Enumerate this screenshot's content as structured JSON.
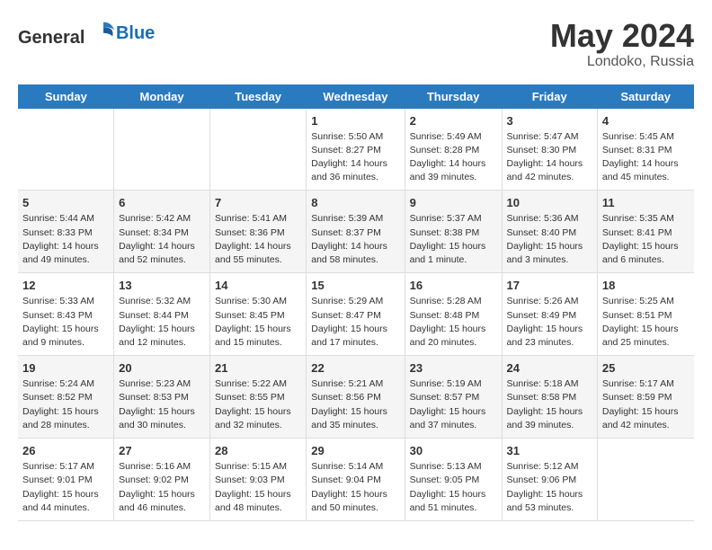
{
  "header": {
    "logo_general": "General",
    "logo_blue": "Blue",
    "month_year": "May 2024",
    "location": "Londoko, Russia"
  },
  "weekdays": [
    "Sunday",
    "Monday",
    "Tuesday",
    "Wednesday",
    "Thursday",
    "Friday",
    "Saturday"
  ],
  "weeks": [
    [
      {
        "day": "",
        "info": ""
      },
      {
        "day": "",
        "info": ""
      },
      {
        "day": "",
        "info": ""
      },
      {
        "day": "1",
        "info": "Sunrise: 5:50 AM\nSunset: 8:27 PM\nDaylight: 14 hours\nand 36 minutes."
      },
      {
        "day": "2",
        "info": "Sunrise: 5:49 AM\nSunset: 8:28 PM\nDaylight: 14 hours\nand 39 minutes."
      },
      {
        "day": "3",
        "info": "Sunrise: 5:47 AM\nSunset: 8:30 PM\nDaylight: 14 hours\nand 42 minutes."
      },
      {
        "day": "4",
        "info": "Sunrise: 5:45 AM\nSunset: 8:31 PM\nDaylight: 14 hours\nand 45 minutes."
      }
    ],
    [
      {
        "day": "5",
        "info": "Sunrise: 5:44 AM\nSunset: 8:33 PM\nDaylight: 14 hours\nand 49 minutes."
      },
      {
        "day": "6",
        "info": "Sunrise: 5:42 AM\nSunset: 8:34 PM\nDaylight: 14 hours\nand 52 minutes."
      },
      {
        "day": "7",
        "info": "Sunrise: 5:41 AM\nSunset: 8:36 PM\nDaylight: 14 hours\nand 55 minutes."
      },
      {
        "day": "8",
        "info": "Sunrise: 5:39 AM\nSunset: 8:37 PM\nDaylight: 14 hours\nand 58 minutes."
      },
      {
        "day": "9",
        "info": "Sunrise: 5:37 AM\nSunset: 8:38 PM\nDaylight: 15 hours\nand 1 minute."
      },
      {
        "day": "10",
        "info": "Sunrise: 5:36 AM\nSunset: 8:40 PM\nDaylight: 15 hours\nand 3 minutes."
      },
      {
        "day": "11",
        "info": "Sunrise: 5:35 AM\nSunset: 8:41 PM\nDaylight: 15 hours\nand 6 minutes."
      }
    ],
    [
      {
        "day": "12",
        "info": "Sunrise: 5:33 AM\nSunset: 8:43 PM\nDaylight: 15 hours\nand 9 minutes."
      },
      {
        "day": "13",
        "info": "Sunrise: 5:32 AM\nSunset: 8:44 PM\nDaylight: 15 hours\nand 12 minutes."
      },
      {
        "day": "14",
        "info": "Sunrise: 5:30 AM\nSunset: 8:45 PM\nDaylight: 15 hours\nand 15 minutes."
      },
      {
        "day": "15",
        "info": "Sunrise: 5:29 AM\nSunset: 8:47 PM\nDaylight: 15 hours\nand 17 minutes."
      },
      {
        "day": "16",
        "info": "Sunrise: 5:28 AM\nSunset: 8:48 PM\nDaylight: 15 hours\nand 20 minutes."
      },
      {
        "day": "17",
        "info": "Sunrise: 5:26 AM\nSunset: 8:49 PM\nDaylight: 15 hours\nand 23 minutes."
      },
      {
        "day": "18",
        "info": "Sunrise: 5:25 AM\nSunset: 8:51 PM\nDaylight: 15 hours\nand 25 minutes."
      }
    ],
    [
      {
        "day": "19",
        "info": "Sunrise: 5:24 AM\nSunset: 8:52 PM\nDaylight: 15 hours\nand 28 minutes."
      },
      {
        "day": "20",
        "info": "Sunrise: 5:23 AM\nSunset: 8:53 PM\nDaylight: 15 hours\nand 30 minutes."
      },
      {
        "day": "21",
        "info": "Sunrise: 5:22 AM\nSunset: 8:55 PM\nDaylight: 15 hours\nand 32 minutes."
      },
      {
        "day": "22",
        "info": "Sunrise: 5:21 AM\nSunset: 8:56 PM\nDaylight: 15 hours\nand 35 minutes."
      },
      {
        "day": "23",
        "info": "Sunrise: 5:19 AM\nSunset: 8:57 PM\nDaylight: 15 hours\nand 37 minutes."
      },
      {
        "day": "24",
        "info": "Sunrise: 5:18 AM\nSunset: 8:58 PM\nDaylight: 15 hours\nand 39 minutes."
      },
      {
        "day": "25",
        "info": "Sunrise: 5:17 AM\nSunset: 8:59 PM\nDaylight: 15 hours\nand 42 minutes."
      }
    ],
    [
      {
        "day": "26",
        "info": "Sunrise: 5:17 AM\nSunset: 9:01 PM\nDaylight: 15 hours\nand 44 minutes."
      },
      {
        "day": "27",
        "info": "Sunrise: 5:16 AM\nSunset: 9:02 PM\nDaylight: 15 hours\nand 46 minutes."
      },
      {
        "day": "28",
        "info": "Sunrise: 5:15 AM\nSunset: 9:03 PM\nDaylight: 15 hours\nand 48 minutes."
      },
      {
        "day": "29",
        "info": "Sunrise: 5:14 AM\nSunset: 9:04 PM\nDaylight: 15 hours\nand 50 minutes."
      },
      {
        "day": "30",
        "info": "Sunrise: 5:13 AM\nSunset: 9:05 PM\nDaylight: 15 hours\nand 51 minutes."
      },
      {
        "day": "31",
        "info": "Sunrise: 5:12 AM\nSunset: 9:06 PM\nDaylight: 15 hours\nand 53 minutes."
      },
      {
        "day": "",
        "info": ""
      }
    ]
  ]
}
